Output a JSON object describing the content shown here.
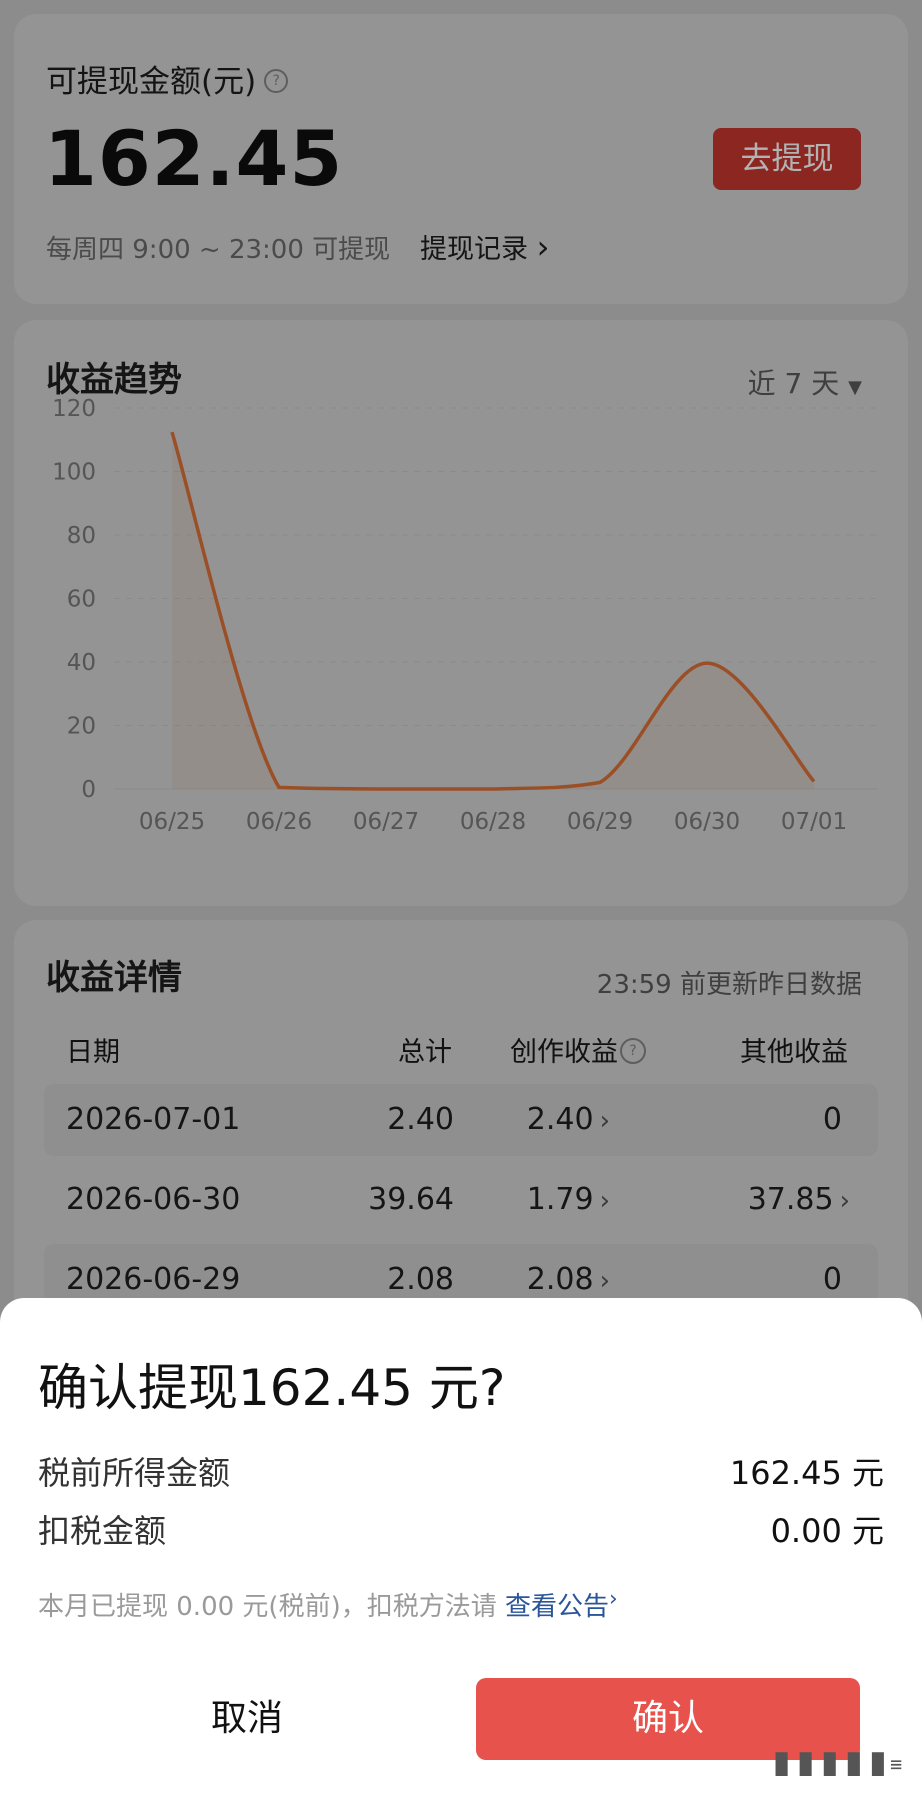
{
  "balance": {
    "label": "可提现金额(元)",
    "help_icon": "question-circle-icon",
    "amount": "162.45",
    "withdraw_button": "去提现",
    "schedule": "每周四 9:00 ~ 23:00 可提现",
    "records_link": "提现记录",
    "records_chevron": "›"
  },
  "trend": {
    "title": "收益趋势",
    "range": "近 7 天",
    "range_icon": "caret-down-icon"
  },
  "chart_data": {
    "type": "line",
    "x": [
      "06/25",
      "06/26",
      "06/27",
      "06/28",
      "06/29",
      "06/30",
      "07/01"
    ],
    "series": [
      {
        "values": [
          112.4,
          0.5,
          0.0,
          0.0,
          2.08,
          39.64,
          2.4
        ]
      }
    ],
    "ylim": [
      0,
      120
    ],
    "yticks": [
      0,
      20,
      40,
      60,
      80,
      100,
      120
    ],
    "grid": true,
    "line_color": "#9a4f26"
  },
  "details": {
    "title": "收益详情",
    "note": "23:59 前更新昨日数据",
    "columns": {
      "date": "日期",
      "total": "总计",
      "creation": "创作收益",
      "other": "其他收益"
    },
    "rows": [
      {
        "date": "2026-07-01",
        "total": "2.40",
        "creation": "2.40",
        "other": "0"
      },
      {
        "date": "2026-06-30",
        "total": "39.64",
        "creation": "1.79",
        "other": "37.85"
      },
      {
        "date": "2026-06-29",
        "total": "2.08",
        "creation": "2.08",
        "other": "0"
      }
    ]
  },
  "dialog": {
    "title": "确认提现162.45 元?",
    "pretax_label": "税前所得金额",
    "pretax_value": "162.45 元",
    "tax_label": "扣税金额",
    "tax_value": "0.00 元",
    "note": "本月已提现 0.00 元(税前)，扣税方法请",
    "note_link": "查看公告",
    "note_link_chevron": "›",
    "cancel": "取消",
    "confirm": "确认"
  },
  "colors": {
    "confirm_button": "#e8524c",
    "link": "#2a5599",
    "overlay": "#8c8c8c"
  }
}
